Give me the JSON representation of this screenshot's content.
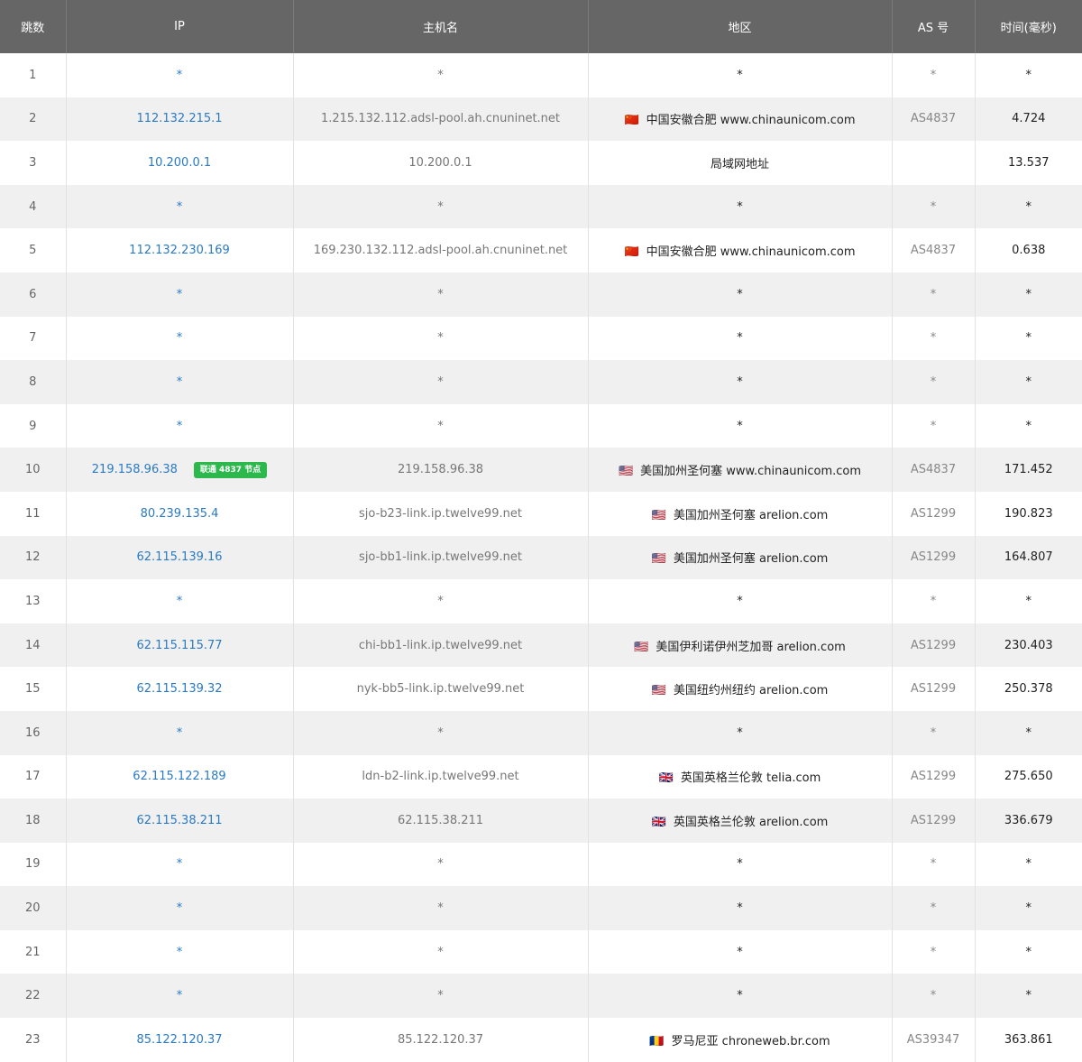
{
  "headers": {
    "hop": "跳数",
    "ip": "IP",
    "host": "主机名",
    "region": "地区",
    "as": "AS 号",
    "time": "时间(毫秒)"
  },
  "colors": {
    "header_bg": "#666666",
    "ip_link": "#2a7ac4",
    "badge_bg": "#2db84d",
    "row_alt": "#f0f0f0"
  },
  "rows": [
    {
      "hop": "1",
      "ip": "*",
      "host": "*",
      "flag": "",
      "region": "*",
      "as": "*",
      "time": "*"
    },
    {
      "hop": "2",
      "ip": "112.132.215.1",
      "host": "1.215.132.112.adsl-pool.ah.cnuninet.net",
      "flag": "🇨🇳",
      "region": "中国安徽合肥 www.chinaunicom.com",
      "as": "AS4837",
      "time": "4.724"
    },
    {
      "hop": "3",
      "ip": "10.200.0.1",
      "host": "10.200.0.1",
      "flag": "",
      "region": "局域网地址",
      "as": "",
      "time": "13.537"
    },
    {
      "hop": "4",
      "ip": "*",
      "host": "*",
      "flag": "",
      "region": "*",
      "as": "*",
      "time": "*"
    },
    {
      "hop": "5",
      "ip": "112.132.230.169",
      "host": "169.230.132.112.adsl-pool.ah.cnuninet.net",
      "flag": "🇨🇳",
      "region": "中国安徽合肥 www.chinaunicom.com",
      "as": "AS4837",
      "time": "0.638"
    },
    {
      "hop": "6",
      "ip": "*",
      "host": "*",
      "flag": "",
      "region": "*",
      "as": "*",
      "time": "*"
    },
    {
      "hop": "7",
      "ip": "*",
      "host": "*",
      "flag": "",
      "region": "*",
      "as": "*",
      "time": "*"
    },
    {
      "hop": "8",
      "ip": "*",
      "host": "*",
      "flag": "",
      "region": "*",
      "as": "*",
      "time": "*"
    },
    {
      "hop": "9",
      "ip": "*",
      "host": "*",
      "flag": "",
      "region": "*",
      "as": "*",
      "time": "*"
    },
    {
      "hop": "10",
      "ip": "219.158.96.38",
      "badge": "联通 4837 节点",
      "host": "219.158.96.38",
      "flag": "🇺🇸",
      "region": "美国加州圣何塞 www.chinaunicom.com",
      "as": "AS4837",
      "time": "171.452"
    },
    {
      "hop": "11",
      "ip": "80.239.135.4",
      "host": "sjo-b23-link.ip.twelve99.net",
      "flag": "🇺🇸",
      "region": "美国加州圣何塞 arelion.com",
      "as": "AS1299",
      "time": "190.823"
    },
    {
      "hop": "12",
      "ip": "62.115.139.16",
      "host": "sjo-bb1-link.ip.twelve99.net",
      "flag": "🇺🇸",
      "region": "美国加州圣何塞 arelion.com",
      "as": "AS1299",
      "time": "164.807"
    },
    {
      "hop": "13",
      "ip": "*",
      "host": "*",
      "flag": "",
      "region": "*",
      "as": "*",
      "time": "*"
    },
    {
      "hop": "14",
      "ip": "62.115.115.77",
      "host": "chi-bb1-link.ip.twelve99.net",
      "flag": "🇺🇸",
      "region": "美国伊利诺伊州芝加哥 arelion.com",
      "as": "AS1299",
      "time": "230.403"
    },
    {
      "hop": "15",
      "ip": "62.115.139.32",
      "host": "nyk-bb5-link.ip.twelve99.net",
      "flag": "🇺🇸",
      "region": "美国纽约州纽约 arelion.com",
      "as": "AS1299",
      "time": "250.378"
    },
    {
      "hop": "16",
      "ip": "*",
      "host": "*",
      "flag": "",
      "region": "*",
      "as": "*",
      "time": "*"
    },
    {
      "hop": "17",
      "ip": "62.115.122.189",
      "host": "ldn-b2-link.ip.twelve99.net",
      "flag": "🇬🇧",
      "region": "英国英格兰伦敦 telia.com",
      "as": "AS1299",
      "time": "275.650"
    },
    {
      "hop": "18",
      "ip": "62.115.38.211",
      "host": "62.115.38.211",
      "flag": "🇬🇧",
      "region": "英国英格兰伦敦 arelion.com",
      "as": "AS1299",
      "time": "336.679"
    },
    {
      "hop": "19",
      "ip": "*",
      "host": "*",
      "flag": "",
      "region": "*",
      "as": "*",
      "time": "*"
    },
    {
      "hop": "20",
      "ip": "*",
      "host": "*",
      "flag": "",
      "region": "*",
      "as": "*",
      "time": "*"
    },
    {
      "hop": "21",
      "ip": "*",
      "host": "*",
      "flag": "",
      "region": "*",
      "as": "*",
      "time": "*"
    },
    {
      "hop": "22",
      "ip": "*",
      "host": "*",
      "flag": "",
      "region": "*",
      "as": "*",
      "time": "*"
    },
    {
      "hop": "23",
      "ip": "85.122.120.37",
      "host": "85.122.120.37",
      "flag": "🇷🇴",
      "region": "罗马尼亚 chroneweb.br.com",
      "as": "AS39347",
      "time": "363.861"
    }
  ]
}
